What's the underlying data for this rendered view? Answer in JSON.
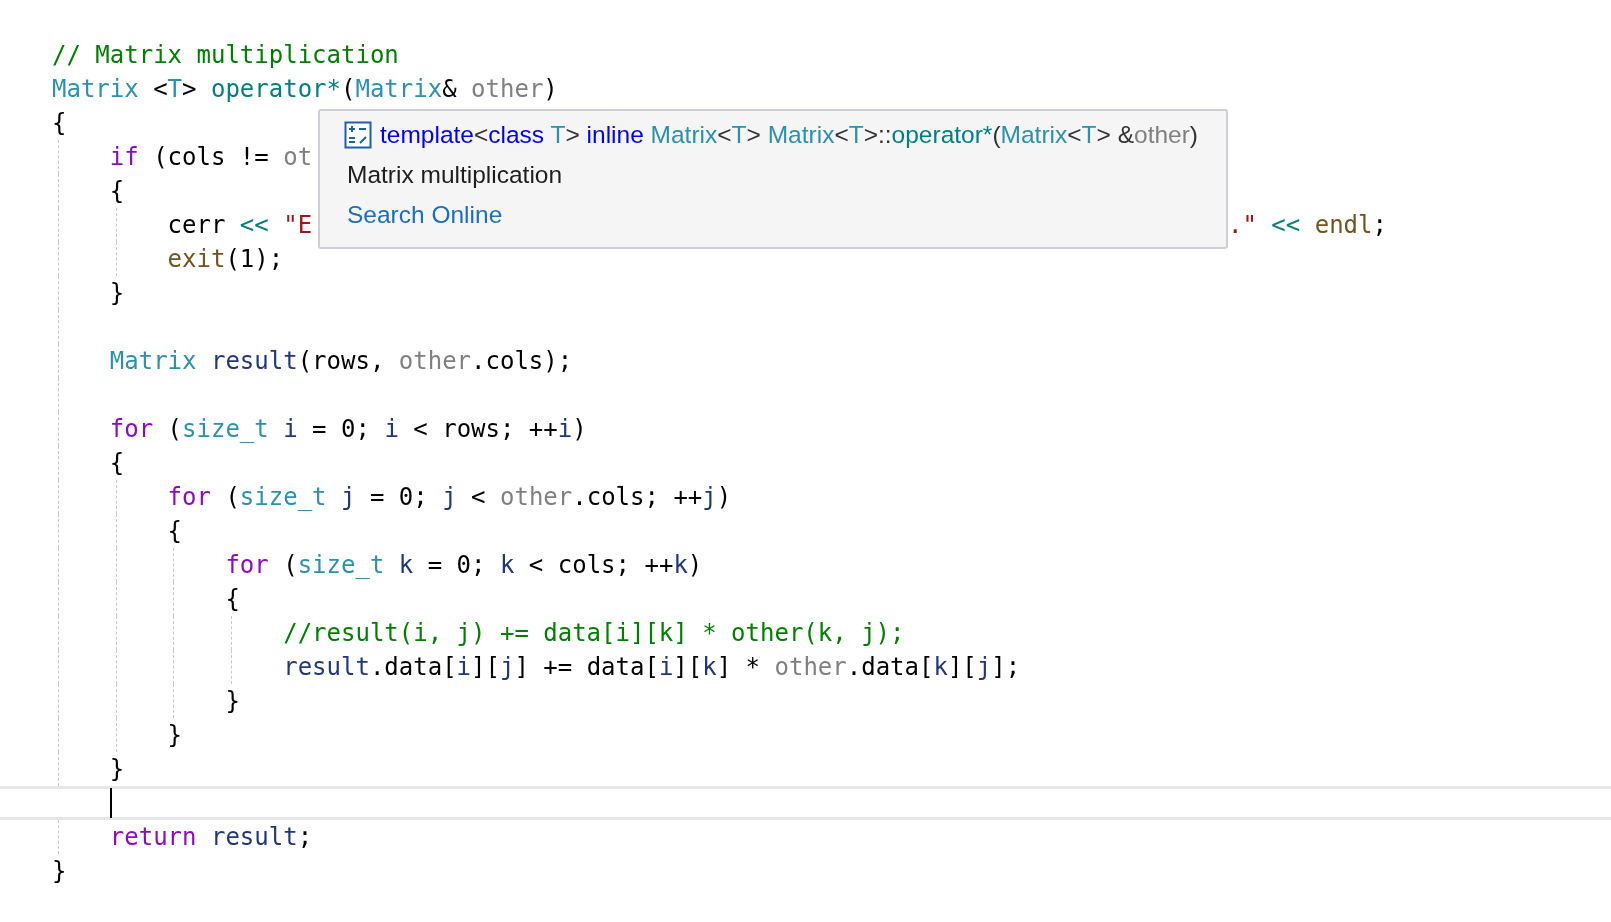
{
  "editor": {
    "lines": [
      {
        "tokens": [
          {
            "kind": "comment",
            "text": "// Matrix multiplication"
          }
        ]
      },
      {
        "tokens": [
          {
            "kind": "type",
            "text": "Matrix"
          },
          {
            "kind": "plain",
            "text": " <"
          },
          {
            "kind": "type",
            "text": "T"
          },
          {
            "kind": "plain",
            "text": "> "
          },
          {
            "kind": "func",
            "text": "operator*"
          },
          {
            "kind": "plain",
            "text": "("
          },
          {
            "kind": "type",
            "text": "Matrix"
          },
          {
            "kind": "plain",
            "text": "& "
          },
          {
            "kind": "param",
            "text": "other"
          },
          {
            "kind": "plain",
            "text": ")"
          }
        ]
      },
      {
        "tokens": [
          {
            "kind": "plain",
            "text": "{"
          }
        ]
      },
      {
        "tokens": [
          {
            "kind": "keyword",
            "text": "    if"
          },
          {
            "kind": "plain",
            "text": " (cols != "
          },
          {
            "kind": "param",
            "text": "ot"
          }
        ]
      },
      {
        "tokens": [
          {
            "kind": "plain",
            "text": "    {"
          }
        ]
      },
      {
        "tokens": [
          {
            "kind": "plain",
            "text": "        cerr "
          },
          {
            "kind": "op",
            "text": "<< "
          },
          {
            "kind": "string",
            "text": "\"E"
          }
        ],
        "after_tooltip": [
          {
            "kind": "string",
            "text": ".\" "
          },
          {
            "kind": "op",
            "text": "<< "
          },
          {
            "kind": "call",
            "text": "endl"
          },
          {
            "kind": "plain",
            "text": ";"
          }
        ]
      },
      {
        "tokens": [
          {
            "kind": "call",
            "text": "        exit"
          },
          {
            "kind": "plain",
            "text": "(1);"
          }
        ]
      },
      {
        "tokens": [
          {
            "kind": "plain",
            "text": "    }"
          }
        ]
      },
      {
        "blank": true
      },
      {
        "tokens": [
          {
            "kind": "type",
            "text": "    Matrix "
          },
          {
            "kind": "local",
            "text": "result"
          },
          {
            "kind": "plain",
            "text": "(rows, "
          },
          {
            "kind": "param",
            "text": "other"
          },
          {
            "kind": "plain",
            "text": ".cols);"
          }
        ]
      },
      {
        "blank": true
      },
      {
        "tokens": [
          {
            "kind": "keyword",
            "text": "    for"
          },
          {
            "kind": "plain",
            "text": " ("
          },
          {
            "kind": "type",
            "text": "size_t "
          },
          {
            "kind": "local",
            "text": "i"
          },
          {
            "kind": "plain",
            "text": " = 0; "
          },
          {
            "kind": "local",
            "text": "i"
          },
          {
            "kind": "plain",
            "text": " < rows; ++"
          },
          {
            "kind": "local",
            "text": "i"
          },
          {
            "kind": "plain",
            "text": ")"
          }
        ]
      },
      {
        "tokens": [
          {
            "kind": "plain",
            "text": "    {"
          }
        ]
      },
      {
        "tokens": [
          {
            "kind": "keyword",
            "text": "        for"
          },
          {
            "kind": "plain",
            "text": " ("
          },
          {
            "kind": "type",
            "text": "size_t "
          },
          {
            "kind": "local",
            "text": "j"
          },
          {
            "kind": "plain",
            "text": " = 0; "
          },
          {
            "kind": "local",
            "text": "j"
          },
          {
            "kind": "plain",
            "text": " < "
          },
          {
            "kind": "param",
            "text": "other"
          },
          {
            "kind": "plain",
            "text": ".cols; ++"
          },
          {
            "kind": "local",
            "text": "j"
          },
          {
            "kind": "plain",
            "text": ")"
          }
        ]
      },
      {
        "tokens": [
          {
            "kind": "plain",
            "text": "        {"
          }
        ]
      },
      {
        "tokens": [
          {
            "kind": "keyword",
            "text": "            for"
          },
          {
            "kind": "plain",
            "text": " ("
          },
          {
            "kind": "type",
            "text": "size_t "
          },
          {
            "kind": "local",
            "text": "k"
          },
          {
            "kind": "plain",
            "text": " = 0; "
          },
          {
            "kind": "local",
            "text": "k"
          },
          {
            "kind": "plain",
            "text": " < cols; ++"
          },
          {
            "kind": "local",
            "text": "k"
          },
          {
            "kind": "plain",
            "text": ")"
          }
        ]
      },
      {
        "tokens": [
          {
            "kind": "plain",
            "text": "            {"
          }
        ]
      },
      {
        "tokens": [
          {
            "kind": "comment",
            "text": "                //result(i, j) += data[i][k] * other(k, j);"
          }
        ]
      },
      {
        "tokens": [
          {
            "kind": "local",
            "text": "                result"
          },
          {
            "kind": "plain",
            "text": ".data["
          },
          {
            "kind": "local",
            "text": "i"
          },
          {
            "kind": "plain",
            "text": "]["
          },
          {
            "kind": "local",
            "text": "j"
          },
          {
            "kind": "plain",
            "text": "] += data["
          },
          {
            "kind": "local",
            "text": "i"
          },
          {
            "kind": "plain",
            "text": "]["
          },
          {
            "kind": "local",
            "text": "k"
          },
          {
            "kind": "plain",
            "text": "] * "
          },
          {
            "kind": "param",
            "text": "other"
          },
          {
            "kind": "plain",
            "text": ".data["
          },
          {
            "kind": "local",
            "text": "k"
          },
          {
            "kind": "plain",
            "text": "]["
          },
          {
            "kind": "local",
            "text": "j"
          },
          {
            "kind": "plain",
            "text": "];"
          }
        ]
      },
      {
        "tokens": [
          {
            "kind": "plain",
            "text": "            }"
          }
        ]
      },
      {
        "tokens": [
          {
            "kind": "plain",
            "text": "        }"
          }
        ]
      },
      {
        "tokens": [
          {
            "kind": "plain",
            "text": "    }"
          }
        ]
      },
      {
        "current": true
      },
      {
        "tokens": [
          {
            "kind": "keyword",
            "text": "    return "
          },
          {
            "kind": "local",
            "text": "result"
          },
          {
            "kind": "plain",
            "text": ";"
          }
        ]
      },
      {
        "tokens": [
          {
            "kind": "plain",
            "text": "}"
          }
        ]
      }
    ]
  },
  "tooltip": {
    "signature": [
      {
        "kind": "keyword",
        "text": "template"
      },
      {
        "kind": "plain",
        "text": "<"
      },
      {
        "kind": "keyword",
        "text": "class "
      },
      {
        "kind": "type",
        "text": "T"
      },
      {
        "kind": "plain",
        "text": "> "
      },
      {
        "kind": "keyword",
        "text": "inline "
      },
      {
        "kind": "type",
        "text": "Matrix"
      },
      {
        "kind": "plain",
        "text": "<"
      },
      {
        "kind": "type",
        "text": "T"
      },
      {
        "kind": "plain",
        "text": "> "
      },
      {
        "kind": "type",
        "text": "Matrix"
      },
      {
        "kind": "plain",
        "text": "<"
      },
      {
        "kind": "type",
        "text": "T"
      },
      {
        "kind": "plain",
        "text": ">::"
      },
      {
        "kind": "func",
        "text": "operator*"
      },
      {
        "kind": "plain",
        "text": "("
      },
      {
        "kind": "type",
        "text": "Matrix"
      },
      {
        "kind": "plain",
        "text": "<"
      },
      {
        "kind": "type",
        "text": "T"
      },
      {
        "kind": "plain",
        "text": "> &"
      },
      {
        "kind": "param",
        "text": "other"
      },
      {
        "kind": "plain",
        "text": ")"
      }
    ],
    "description": "Matrix multiplication",
    "link": "Search Online"
  }
}
